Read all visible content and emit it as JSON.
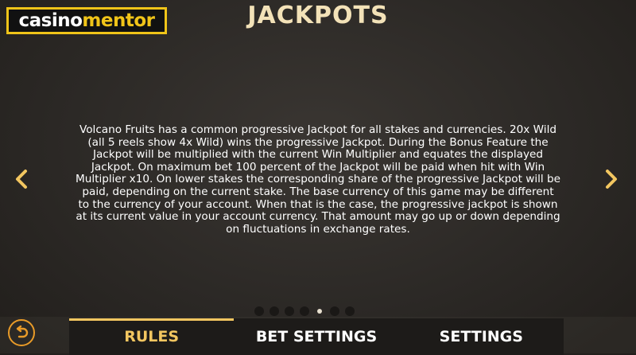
{
  "brand": {
    "part1": "casino",
    "part2": "mentor"
  },
  "page": {
    "title": "JACKPOTS"
  },
  "content": {
    "text": "Volcano Fruits has a common progressive Jackpot for all stakes and currencies. 20x Wild (all 5 reels show 4x Wild) wins the progressive Jackpot. During the Bonus Feature the Jackpot will be multiplied with the current Win Multiplier and equates the displayed Jackpot. On maximum bet 100 percent of the Jackpot will be paid when hit with Win Multiplier x10. On lower stakes the corresponding share of the progressive Jackpot will be paid, depending on the current stake. The base currency of this game may be different to the currency of your account. When that is the case, the progressive jackpot is shown at its current value in your account currency. That amount may go up or down depending on fluctuations in exchange rates."
  },
  "pagination": {
    "total": 7,
    "active": 5
  },
  "nav": {
    "prev_icon": "chevron-left-icon",
    "next_icon": "chevron-right-icon",
    "back_icon": "undo-arrow-icon"
  },
  "tabs": [
    {
      "label": "RULES",
      "active": true
    },
    {
      "label": "BET SETTINGS",
      "active": false
    },
    {
      "label": "SETTINGS",
      "active": false
    }
  ],
  "colors": {
    "accent": "#f2c660",
    "logo_yellow": "#f0c419",
    "back_ring": "#e99b28"
  }
}
